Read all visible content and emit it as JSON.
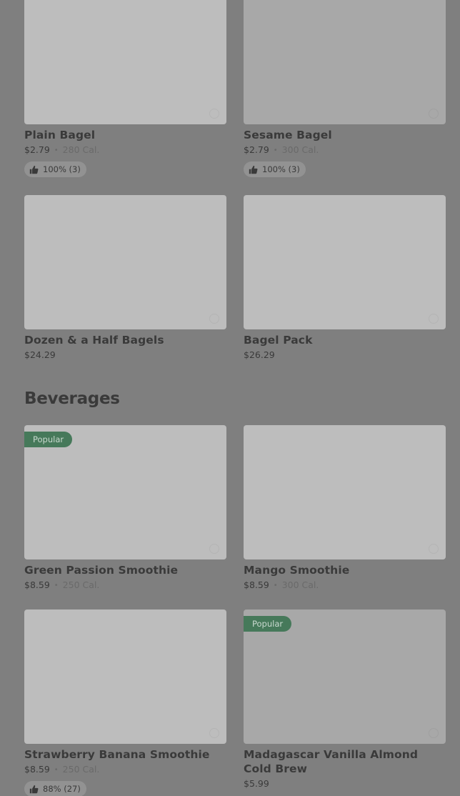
{
  "colors": {
    "background": "#7f7f7f",
    "popular_badge": "#46795a",
    "image_placeholder": "#bdbdbd"
  },
  "bagels": {
    "items": [
      {
        "name": "Plain Bagel",
        "price": "$2.79",
        "separator": "•",
        "calories": "280 Cal.",
        "rating": "100% (3)",
        "rating_icon": "thumbs-up-icon"
      },
      {
        "name": "Sesame Bagel",
        "price": "$2.79",
        "separator": "•",
        "calories": "300 Cal.",
        "rating": "100% (3)",
        "rating_icon": "thumbs-up-icon"
      },
      {
        "name": "Dozen & a Half Bagels",
        "price": "$24.29"
      },
      {
        "name": "Bagel Pack",
        "price": "$26.29"
      }
    ]
  },
  "beverages": {
    "title": "Beverages",
    "items": [
      {
        "badge": "Popular",
        "name": "Green Passion Smoothie",
        "price": "$8.59",
        "separator": "•",
        "calories": "250 Cal."
      },
      {
        "name": "Mango Smoothie",
        "price": "$8.59",
        "separator": "•",
        "calories": "300 Cal."
      },
      {
        "name": "Strawberry Banana Smoothie",
        "price": "$8.59",
        "separator": "•",
        "calories": "250 Cal.",
        "rating": "88% (27)",
        "rating_icon": "thumbs-up-icon"
      },
      {
        "badge": "Popular",
        "name": "Madagascar Vanilla Almond Cold Brew",
        "price": "$5.99"
      }
    ]
  }
}
